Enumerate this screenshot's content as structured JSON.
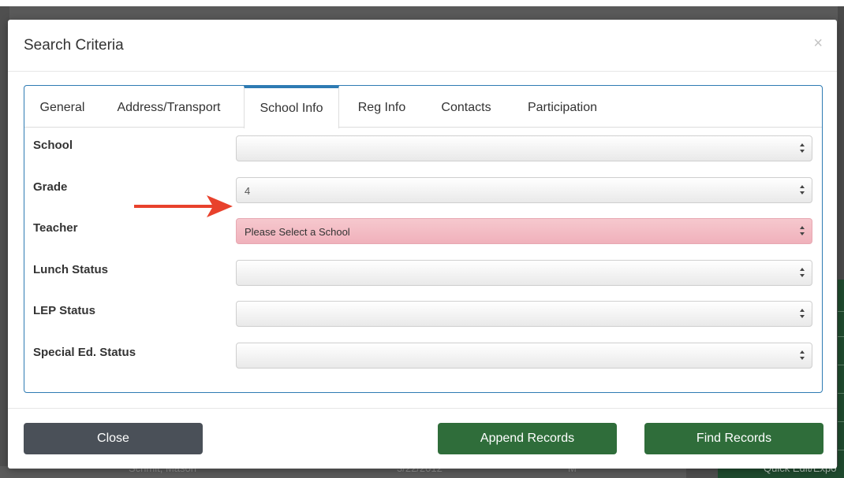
{
  "modal": {
    "title": "Search Criteria",
    "close_glyph": "×"
  },
  "tabs": [
    {
      "label": "General",
      "active": false
    },
    {
      "label": "Address/Transport",
      "active": false
    },
    {
      "label": "School Info",
      "active": true
    },
    {
      "label": "Reg Info",
      "active": false
    },
    {
      "label": "Contacts",
      "active": false
    },
    {
      "label": "Participation",
      "active": false
    }
  ],
  "fields": [
    {
      "label": "School",
      "value": ""
    },
    {
      "label": "Grade",
      "value": "4"
    },
    {
      "label": "Teacher",
      "value": "Please Select a School",
      "state": "invalid"
    },
    {
      "label": "Lunch Status",
      "value": ""
    },
    {
      "label": "LEP Status",
      "value": ""
    },
    {
      "label": "Special Ed. Status",
      "value": ""
    }
  ],
  "footer": {
    "close_label": "Close",
    "append_label": "Append Records",
    "find_label": "Find Records"
  },
  "background": {
    "bottom_name": "Schmit, Mason",
    "bottom_date": "3/22/2012",
    "bottom_gender": "M",
    "quick_edit": "Quick Edit/Expo"
  },
  "colors": {
    "accent_blue": "#2e7bb3",
    "button_green": "#2f6d3a",
    "button_gray": "#4a5058",
    "invalid_pink": "#f4bfc7",
    "annotation_red": "#e8412c"
  },
  "icons": {
    "select_arrows": "updown-arrows-icon",
    "annotation": "red-arrow-icon"
  }
}
